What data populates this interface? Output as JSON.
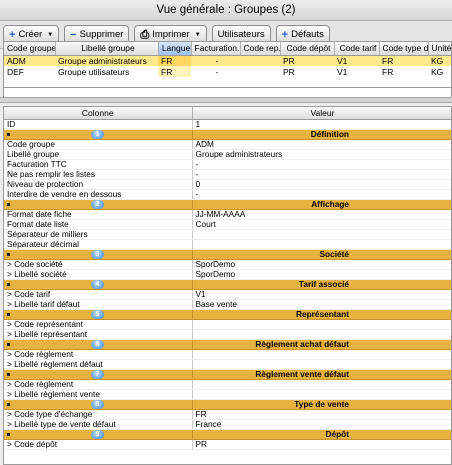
{
  "window": {
    "title": "Vue générale : Groupes  (2)"
  },
  "toolbar": {
    "create_label": "Créer",
    "delete_label": "Supprimer",
    "print_label": "Imprimer",
    "users_label": "Utilisateurs",
    "defaults_label": "Défauts"
  },
  "grid": {
    "columns": [
      "Code groupe",
      "Libellé groupe",
      "Langue",
      "Facturation...",
      "Code rep...",
      "Code dépôt",
      "Code tarif",
      "Code type d'...",
      "Unité"
    ],
    "rows": [
      [
        "ADM",
        "Groupe administrateurs",
        "FR",
        "-",
        "",
        "PR",
        "V1",
        "FR",
        "KG"
      ],
      [
        "DEF",
        "Groupe utilisateurs",
        "FR",
        "-",
        "",
        "PR",
        "V1",
        "FR",
        "KG"
      ]
    ]
  },
  "detail": {
    "header_key": "Colonne",
    "header_value": "Valeur",
    "rows": [
      {
        "k": "ID",
        "v": "1"
      },
      {
        "s": true,
        "n": "1",
        "t": "Définition"
      },
      {
        "k": "Code groupe",
        "v": "ADM"
      },
      {
        "k": "Libellé groupe",
        "v": "Groupe administrateurs"
      },
      {
        "k": "Facturation TTC",
        "v": "-"
      },
      {
        "k": "Ne pas remplir les listes",
        "v": "-"
      },
      {
        "k": "Niveau de protection",
        "v": "0"
      },
      {
        "k": "Interdire de vendre en dessous",
        "v": "-"
      },
      {
        "s": true,
        "n": "2",
        "t": "Affichage"
      },
      {
        "k": "Format date fiche",
        "v": "JJ-MM-AAAA"
      },
      {
        "k": "Format date liste",
        "v": "Court"
      },
      {
        "k": "Séparateur de milliers",
        "v": ""
      },
      {
        "k": "Séparateur décimal",
        "v": ""
      },
      {
        "s": true,
        "n": "3",
        "t": "Société"
      },
      {
        "k": "> Code société",
        "v": "SporDemo"
      },
      {
        "k": "> Libellé société",
        "v": "SporDemo"
      },
      {
        "s": true,
        "n": "4",
        "t": "Tarif associé"
      },
      {
        "k": "> Code tarif",
        "v": "V1"
      },
      {
        "k": "> Libellé tarif défaut",
        "v": "Base vente"
      },
      {
        "s": true,
        "n": "5",
        "t": "Représentant"
      },
      {
        "k": "> Code représentant",
        "v": ""
      },
      {
        "k": "> Libellé représentant",
        "v": ""
      },
      {
        "s": true,
        "n": "6",
        "t": "Règlement achat défaut"
      },
      {
        "k": "> Code règlement",
        "v": ""
      },
      {
        "k": "> Libellé règlement défaut",
        "v": ""
      },
      {
        "s": true,
        "n": "7",
        "t": "Règlement vente défaut"
      },
      {
        "k": "> Code règlement",
        "v": ""
      },
      {
        "k": "> Libellé règlement vente",
        "v": ""
      },
      {
        "s": true,
        "n": "8",
        "t": "Type de vente"
      },
      {
        "k": "> Code type d'échange",
        "v": "FR"
      },
      {
        "k": "> Libellé type de vente défaut",
        "v": "France"
      },
      {
        "s": true,
        "n": "9",
        "t": "Dépôt"
      },
      {
        "k": "> Code dépôt",
        "v": "PR"
      }
    ]
  }
}
